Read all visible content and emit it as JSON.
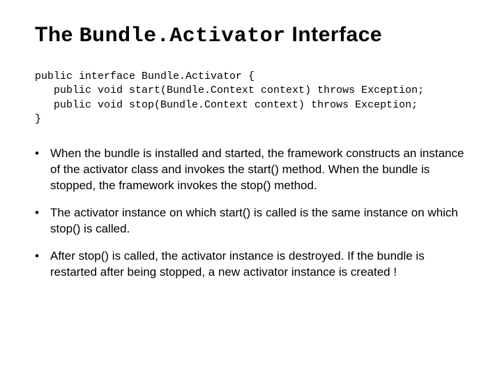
{
  "title": {
    "prefix": "The ",
    "mono": "Bundle.Activator",
    "suffix": " Interface"
  },
  "code": {
    "line1": "public interface Bundle.Activator {",
    "line2": "   public void start(Bundle.Context context) throws Exception;",
    "line3": "   public void stop(Bundle.Context context) throws Exception;",
    "line4": "}"
  },
  "bullets": [
    "When the bundle is installed and started, the framework constructs an instance of the activator class and invokes the start() method. When the bundle is stopped, the framework invokes the stop() method.",
    "The activator instance on which start() is called is the same instance on which stop() is called.",
    "After stop() is called, the activator instance is destroyed. If the bundle is restarted after being stopped, a new activator instance is created !"
  ]
}
